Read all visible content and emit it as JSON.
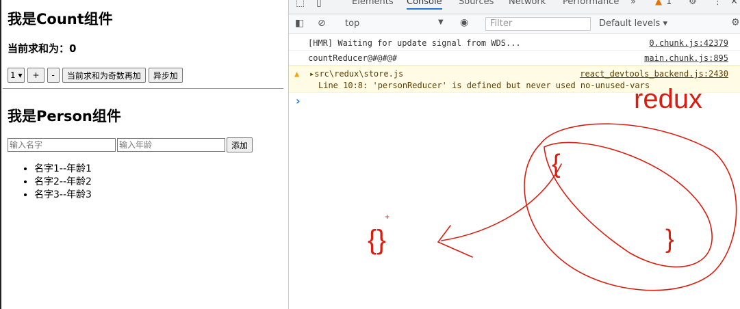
{
  "count": {
    "title": "我是Count组件",
    "sum_label": "当前求和为：0",
    "select_value": "1 ▾",
    "btn_plus": "+",
    "btn_minus": "-",
    "btn_odd": "当前求和为奇数再加",
    "btn_async": "异步加"
  },
  "person": {
    "title": "我是Person组件",
    "name_placeholder": "输入名字",
    "age_placeholder": "输入年龄",
    "btn_add": "添加",
    "list": [
      "名字1--年龄1",
      "名字2--年龄2",
      "名字3--年龄3"
    ]
  },
  "devtools": {
    "tabs": [
      "Elements",
      "Console",
      "Sources",
      "Network",
      "Performance"
    ],
    "more": "»",
    "warn_count": "1",
    "context": "top",
    "filter_placeholder": "Filter",
    "levels": "Default levels ▾",
    "logs": [
      {
        "text": "[HMR] Waiting for update signal from WDS...",
        "source": "0.chunk.js:42379"
      },
      {
        "text": "countReducer@#@#@#",
        "source": "main.chunk.js:895"
      }
    ],
    "warning": {
      "line1": "▸src\\redux\\store.js",
      "line2": "Line 10:8:  'personReducer' is defined but never used  no-unused-vars",
      "source": "react_devtools_backend.js:2430"
    },
    "prompt": "›"
  },
  "annotation": {
    "text": "redux",
    "brace_open": "{",
    "brace_close": "}",
    "obj": "{}",
    "plus": "+",
    "color": "#d81e10"
  }
}
